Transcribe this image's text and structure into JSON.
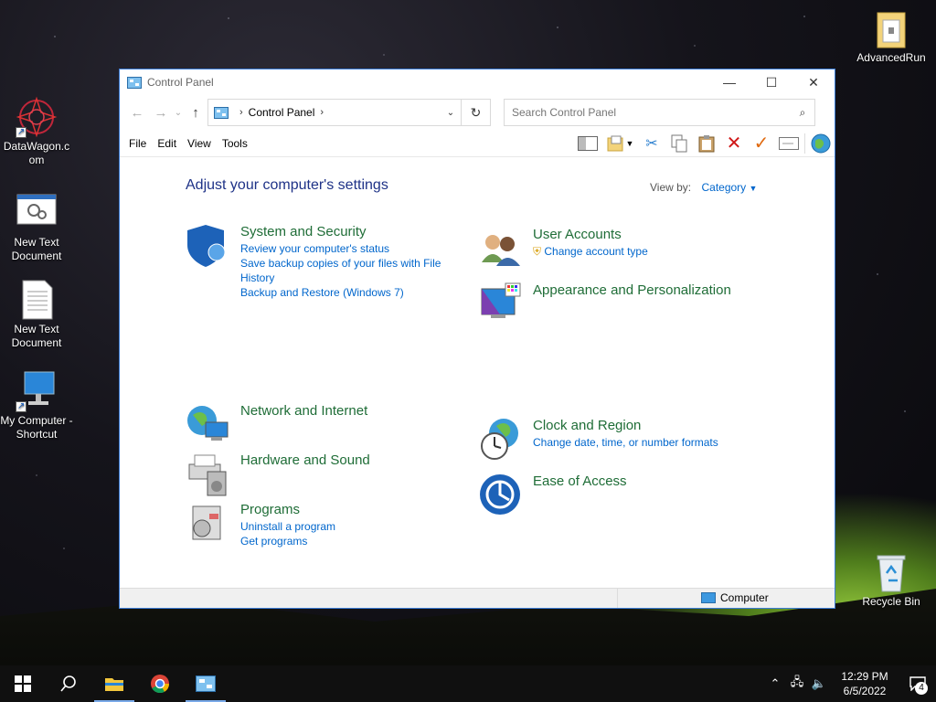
{
  "desktop": {
    "icons": [
      {
        "label": "DataWagon.c om"
      },
      {
        "label": "New Text Document"
      },
      {
        "label": "New Text Document"
      },
      {
        "label": "My Computer - Shortcut"
      },
      {
        "label": "AdvancedRun"
      },
      {
        "label": "Recycle Bin"
      }
    ]
  },
  "window": {
    "title": "Control Panel",
    "address": {
      "crumb": "Control Panel"
    },
    "search": {
      "placeholder": "Search Control Panel"
    },
    "menu": [
      "File",
      "Edit",
      "View",
      "Tools"
    ],
    "heading": "Adjust your computer's settings",
    "view_by": {
      "label": "View by:",
      "value": "Category"
    },
    "categories": {
      "system": {
        "title": "System and Security",
        "links": [
          "Review your computer's status",
          "Save backup copies of your files with File History",
          "Backup and Restore (Windows 7)"
        ]
      },
      "network": {
        "title": "Network and Internet"
      },
      "hardware": {
        "title": "Hardware and Sound"
      },
      "programs": {
        "title": "Programs",
        "links": [
          "Uninstall a program",
          "Get programs"
        ]
      },
      "users": {
        "title": "User Accounts",
        "links": [
          "Change account type"
        ]
      },
      "appearance": {
        "title": "Appearance and Personalization"
      },
      "clock": {
        "title": "Clock and Region",
        "links": [
          "Change date, time, or number formats"
        ]
      },
      "ease": {
        "title": "Ease of Access"
      }
    },
    "status": {
      "computer": "Computer"
    }
  },
  "taskbar": {
    "clock": {
      "time": "12:29 PM",
      "date": "6/5/2022"
    },
    "notifications_count": "4"
  },
  "colors": {
    "accent": "#0066cc",
    "category_title": "#1f6d37",
    "heading": "#1e3287"
  }
}
